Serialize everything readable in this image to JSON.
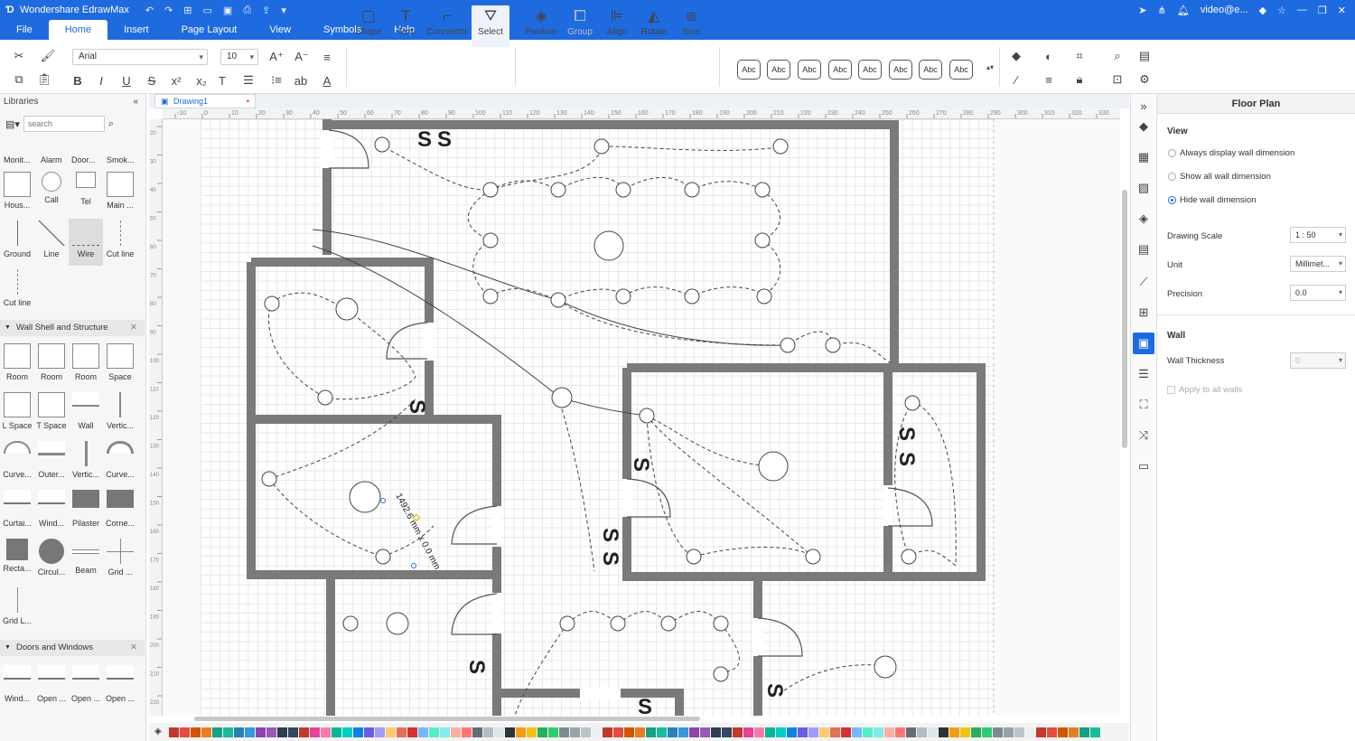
{
  "app": {
    "title": "Wondershare EdrawMax",
    "user": "video@e...",
    "accent": "#1e6be0"
  },
  "menu": [
    "File",
    "Home",
    "Insert",
    "Page Layout",
    "View",
    "Symbols",
    "Help"
  ],
  "ribbon": {
    "font": "Arial",
    "font_size": "10",
    "tools": [
      "Shape",
      "Text",
      "Connector",
      "Select",
      "Position",
      "Group",
      "Align",
      "Rotate",
      "Size"
    ],
    "styles": [
      "Abc",
      "Abc",
      "Abc",
      "Abc",
      "Abc",
      "Abc",
      "Abc",
      "Abc"
    ]
  },
  "libraries": {
    "title": "Libraries",
    "search_placeholder": "search",
    "top_row_labels": [
      "Monit...",
      "Alarm",
      "Door...",
      "Smok..."
    ],
    "row2": [
      "Hous...",
      "Call",
      "Tel",
      "Main ..."
    ],
    "row3": [
      "Ground",
      "Line",
      "Wire",
      "Cut line"
    ],
    "row4": [
      "Cut line"
    ],
    "section_wall": "Wall Shell and Structure",
    "wall_rows": [
      [
        "Room",
        "Room",
        "Room",
        "Space"
      ],
      [
        "L Space",
        "T Space",
        "Wall",
        "Vertic..."
      ],
      [
        "Curve...",
        "Outer...",
        "Vertic...",
        "Curve..."
      ],
      [
        "Curtai...",
        "Wind...",
        "Pilaster",
        "Corne..."
      ],
      [
        "Recta...",
        "Circul...",
        "Beam",
        "Grid ..."
      ],
      [
        "Grid L..."
      ]
    ],
    "section_doors": "Doors and Windows",
    "door_row": [
      "Wind...",
      "Open ...",
      "Open ...",
      "Open ..."
    ]
  },
  "document": {
    "tab": "Drawing1",
    "ruler_h": [
      "-10",
      "0",
      "10",
      "20",
      "30",
      "40",
      "50",
      "60",
      "70",
      "80",
      "90",
      "100",
      "110",
      "120",
      "130",
      "140",
      "150",
      "160",
      "170",
      "180",
      "190",
      "200",
      "210",
      "220",
      "230",
      "240",
      "250",
      "260",
      "270",
      "280",
      "290",
      "300",
      "310",
      "320",
      "330",
      "340"
    ],
    "ruler_v": [
      "20",
      "30",
      "40",
      "50",
      "60",
      "70",
      "80",
      "90",
      "100",
      "110",
      "120",
      "130",
      "140",
      "150",
      "160",
      "170",
      "180",
      "190",
      "200",
      "210",
      "220"
    ],
    "dimension_label": "1492.6 mm x 0.0 mm",
    "switch_label": "S"
  },
  "floor_plan": {
    "title": "Floor Plan",
    "view_label": "View",
    "options": [
      "Always display wall dimension",
      "Show all wall dimension",
      "Hide wall dimension"
    ],
    "selected_option": "Hide wall dimension",
    "drawing_scale_label": "Drawing Scale",
    "drawing_scale": "1 : 50",
    "unit_label": "Unit",
    "unit": "Millimet...",
    "precision_label": "Precision",
    "precision": "0.0",
    "wall_label": "Wall",
    "wall_thickness_label": "Wall Thickness",
    "wall_thickness": "0",
    "apply_all": "Apply to all walls"
  },
  "palette": [
    "#c0392b",
    "#e74c3c",
    "#d35400",
    "#e67e22",
    "#16a085",
    "#1abc9c",
    "#2980b9",
    "#3498db",
    "#8e44ad",
    "#9b59b6",
    "#2c3e50",
    "#34495e",
    "#c0392b",
    "#e84393",
    "#fd79a8",
    "#00b894",
    "#00cec9",
    "#0984e3",
    "#6c5ce7",
    "#a29bfe",
    "#fdcb6e",
    "#e17055",
    "#d63031",
    "#74b9ff",
    "#55efc4",
    "#81ecec",
    "#fab1a0",
    "#ff7675",
    "#636e72",
    "#b2bec3",
    "#dfe6e9",
    "#2d3436",
    "#f39c12",
    "#f1c40f",
    "#27ae60",
    "#2ecc71",
    "#7f8c8d",
    "#95a5a6",
    "#bdc3c7",
    "#ecf0f1"
  ]
}
